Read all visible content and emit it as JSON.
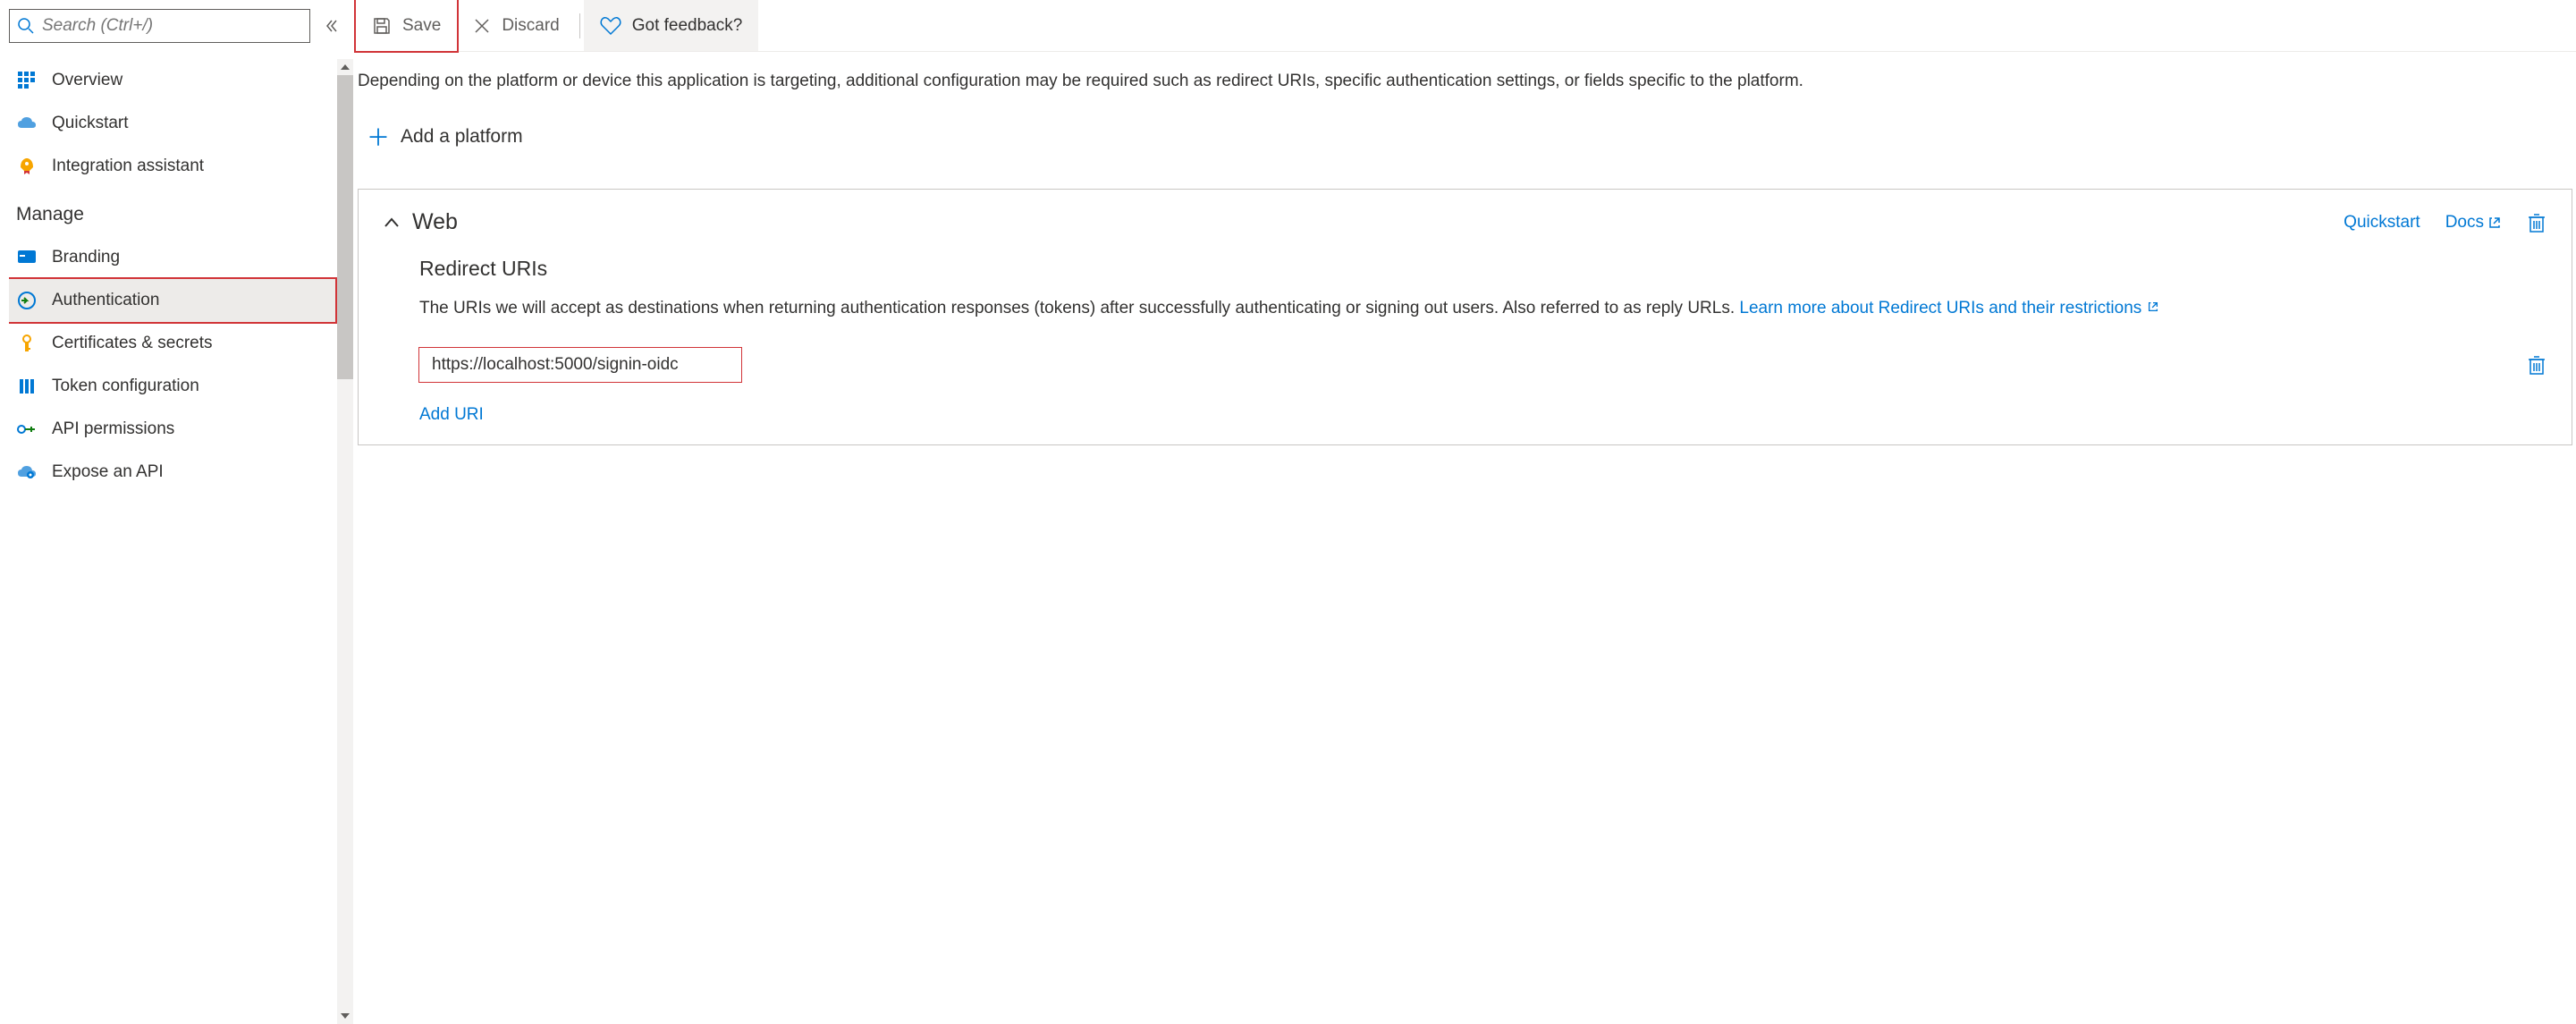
{
  "search": {
    "placeholder": "Search (Ctrl+/)"
  },
  "sidebarTop": [
    {
      "key": "overview",
      "label": "Overview"
    },
    {
      "key": "quickstart",
      "label": "Quickstart"
    },
    {
      "key": "integration",
      "label": "Integration assistant"
    }
  ],
  "sidebarManageHeader": "Manage",
  "sidebarManage": [
    {
      "key": "branding",
      "label": "Branding"
    },
    {
      "key": "authentication",
      "label": "Authentication",
      "selected": true,
      "highlighted": true
    },
    {
      "key": "certificates",
      "label": "Certificates & secrets"
    },
    {
      "key": "tokencfg",
      "label": "Token configuration"
    },
    {
      "key": "apiperm",
      "label": "API permissions"
    },
    {
      "key": "exposeapi",
      "label": "Expose an API"
    }
  ],
  "toolbar": {
    "save": "Save",
    "discard": "Discard",
    "feedback": "Got feedback?"
  },
  "intro": "Depending on the platform or device this application is targeting, additional configuration may be required such as redirect URIs, specific authentication settings, or fields specific to the platform.",
  "addPlatform": "Add a platform",
  "web": {
    "title": "Web",
    "quickstart": "Quickstart",
    "docs": "Docs",
    "redirectHeader": "Redirect URIs",
    "redirectDesc": "The URIs we will accept as destinations when returning authentication responses (tokens) after successfully authenticating or signing out users. Also referred to as reply URLs. ",
    "learnMore": "Learn more about Redirect URIs and their restrictions",
    "uriValue": "https://localhost:5000/signin-oidc",
    "addUri": "Add URI"
  }
}
